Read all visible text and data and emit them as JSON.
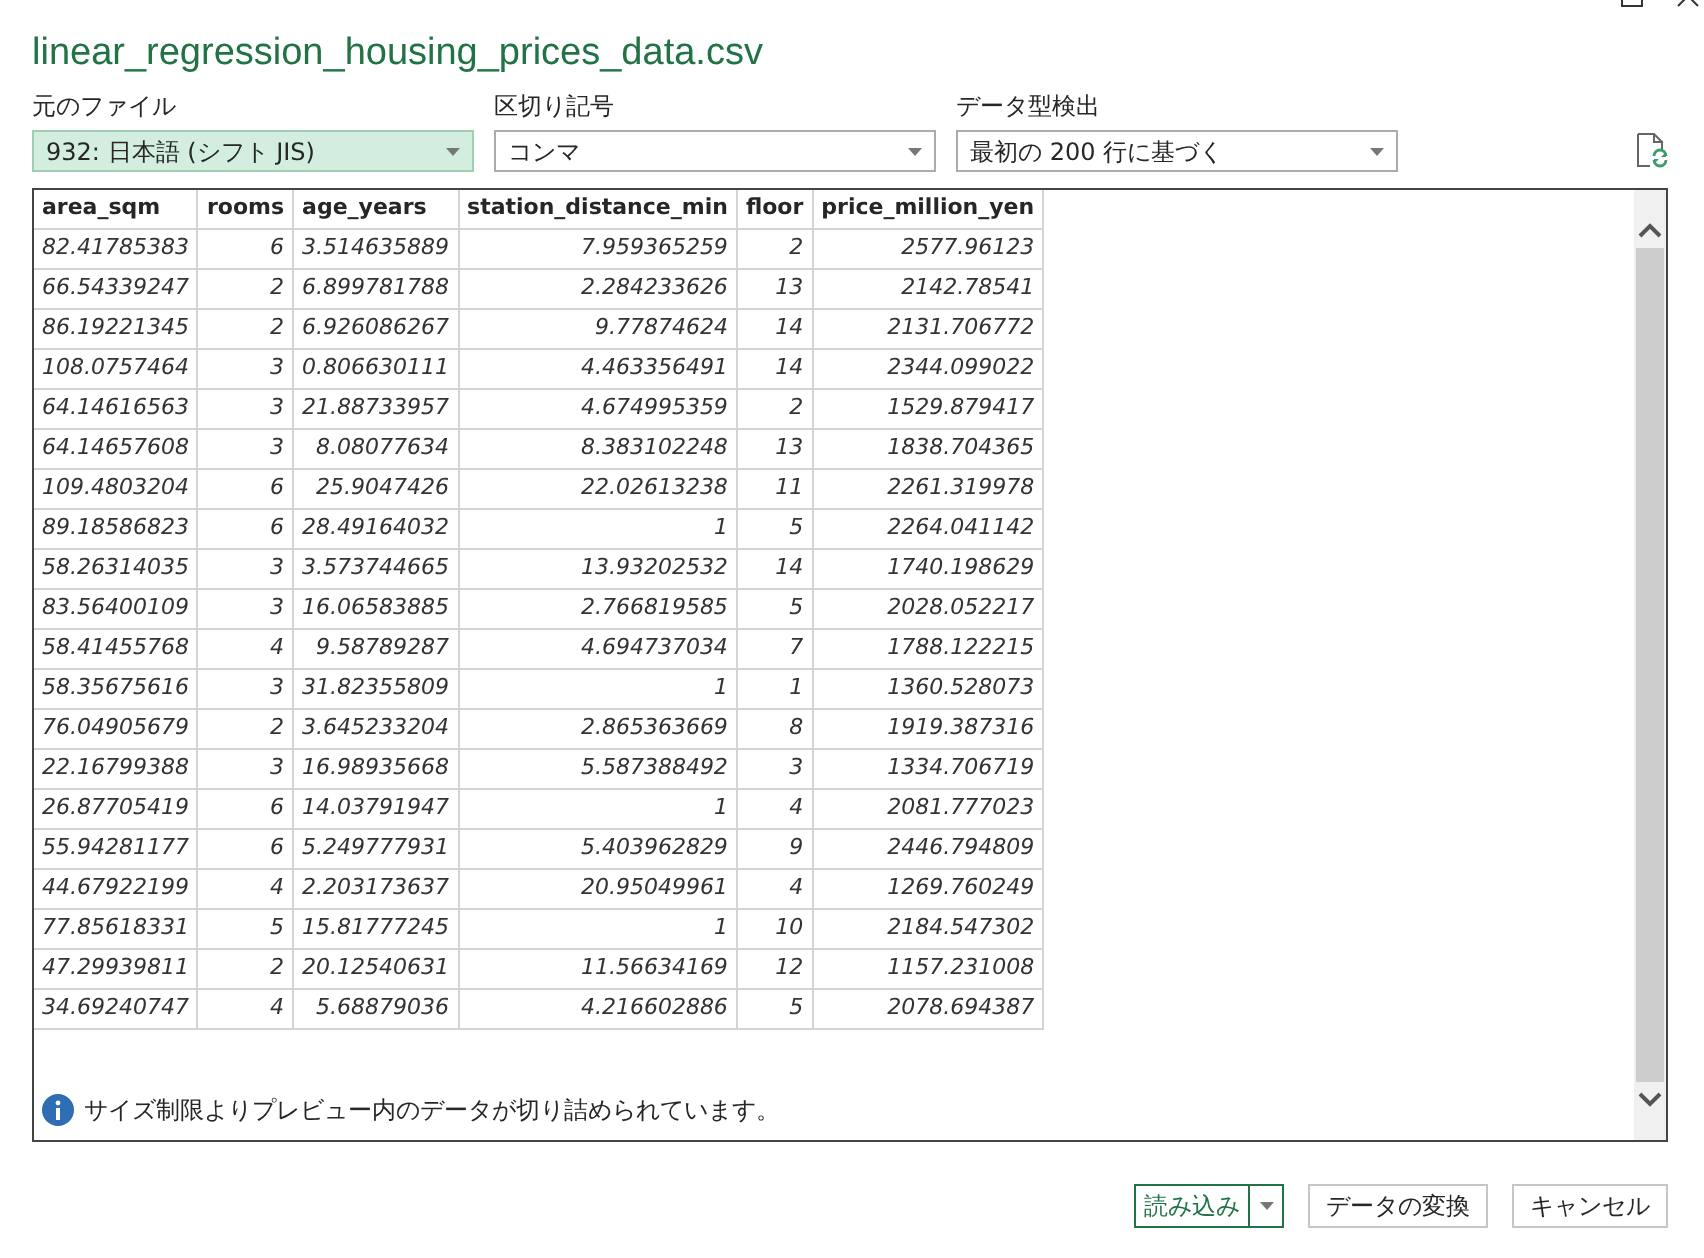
{
  "window": {
    "title": "linear_regression_housing_prices_data.csv"
  },
  "options": [
    {
      "label": "元のファイル",
      "value": "932: 日本語 (シフト JIS)",
      "focused": true
    },
    {
      "label": "区切り記号",
      "value": "コンマ",
      "focused": false
    },
    {
      "label": "データ型検出",
      "value": "最初の 200 行に基づく",
      "focused": false
    }
  ],
  "preview": {
    "columns": [
      "area_sqm",
      "rooms",
      "age_years",
      "station_distance_min",
      "floor",
      "price_million_yen"
    ],
    "rows": [
      [
        "82.41785383",
        "6",
        "3.514635889",
        "7.959365259",
        "2",
        "2577.96123"
      ],
      [
        "66.54339247",
        "2",
        "6.899781788",
        "2.284233626",
        "13",
        "2142.78541"
      ],
      [
        "86.19221345",
        "2",
        "6.926086267",
        "9.77874624",
        "14",
        "2131.706772"
      ],
      [
        "108.0757464",
        "3",
        "0.806630111",
        "4.463356491",
        "14",
        "2344.099022"
      ],
      [
        "64.14616563",
        "3",
        "21.88733957",
        "4.674995359",
        "2",
        "1529.879417"
      ],
      [
        "64.14657608",
        "3",
        "8.08077634",
        "8.383102248",
        "13",
        "1838.704365"
      ],
      [
        "109.4803204",
        "6",
        "25.9047426",
        "22.02613238",
        "11",
        "2261.319978"
      ],
      [
        "89.18586823",
        "6",
        "28.49164032",
        "1",
        "5",
        "2264.041142"
      ],
      [
        "58.26314035",
        "3",
        "3.573744665",
        "13.93202532",
        "14",
        "1740.198629"
      ],
      [
        "83.56400109",
        "3",
        "16.06583885",
        "2.766819585",
        "5",
        "2028.052217"
      ],
      [
        "58.41455768",
        "4",
        "9.58789287",
        "4.694737034",
        "7",
        "1788.122215"
      ],
      [
        "58.35675616",
        "3",
        "31.82355809",
        "1",
        "1",
        "1360.528073"
      ],
      [
        "76.04905679",
        "2",
        "3.645233204",
        "2.865363669",
        "8",
        "1919.387316"
      ],
      [
        "22.16799388",
        "3",
        "16.98935668",
        "5.587388492",
        "3",
        "1334.706719"
      ],
      [
        "26.87705419",
        "6",
        "14.03791947",
        "1",
        "4",
        "2081.777023"
      ],
      [
        "55.94281177",
        "6",
        "5.249777931",
        "5.403962829",
        "9",
        "2446.794809"
      ],
      [
        "44.67922199",
        "4",
        "2.203173637",
        "20.95049961",
        "4",
        "1269.760249"
      ],
      [
        "77.85618331",
        "5",
        "15.81777245",
        "1",
        "10",
        "2184.547302"
      ],
      [
        "47.29939811",
        "2",
        "20.12540631",
        "11.56634169",
        "12",
        "1157.231008"
      ],
      [
        "34.69240747",
        "4",
        "5.68879036",
        "4.216602886",
        "5",
        "2078.694387"
      ]
    ],
    "notice": "サイズ制限よりプレビュー内のデータが切り詰められています。"
  },
  "buttons": [
    {
      "label": "読み込み",
      "kind": "split"
    },
    {
      "label": "データの変換",
      "kind": "plain"
    },
    {
      "label": "キャンセル",
      "kind": "plain"
    }
  ]
}
